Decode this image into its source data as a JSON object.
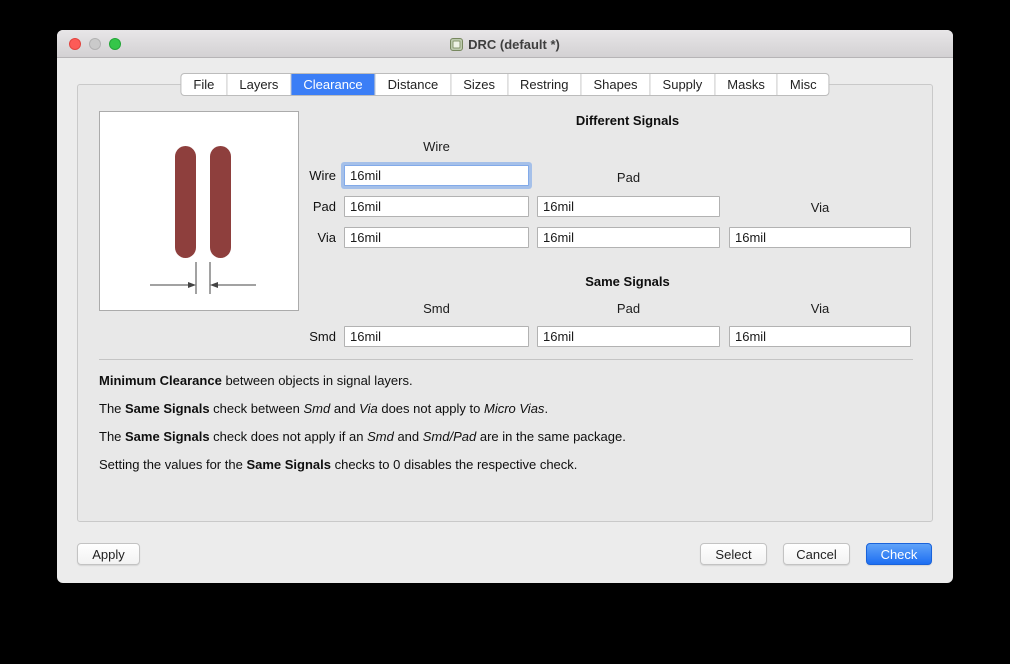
{
  "window": {
    "title": "DRC (default *)"
  },
  "tabs": {
    "items": [
      {
        "label": "File",
        "selected": false
      },
      {
        "label": "Layers",
        "selected": false
      },
      {
        "label": "Clearance",
        "selected": true
      },
      {
        "label": "Distance",
        "selected": false
      },
      {
        "label": "Sizes",
        "selected": false
      },
      {
        "label": "Restring",
        "selected": false
      },
      {
        "label": "Shapes",
        "selected": false
      },
      {
        "label": "Supply",
        "selected": false
      },
      {
        "label": "Masks",
        "selected": false
      },
      {
        "label": "Misc",
        "selected": false
      }
    ]
  },
  "clearance_tab": {
    "different_signals": {
      "heading": "Different Signals",
      "columns": {
        "wire": "Wire",
        "pad": "Pad",
        "via": "Via"
      },
      "rows": {
        "wire": {
          "label": "Wire",
          "wire": "16mil"
        },
        "pad": {
          "label": "Pad",
          "wire": "16mil",
          "pad": "16mil"
        },
        "via": {
          "label": "Via",
          "wire": "16mil",
          "pad": "16mil",
          "via": "16mil"
        }
      }
    },
    "same_signals": {
      "heading": "Same Signals",
      "columns": {
        "smd": "Smd",
        "pad": "Pad",
        "via": "Via"
      },
      "rows": {
        "smd": {
          "label": "Smd",
          "smd": "16mil",
          "pad": "16mil",
          "via": "16mil"
        }
      }
    },
    "notes": [
      [
        {
          "text": "Minimum Clearance",
          "style": "b"
        },
        {
          "text": " between objects in signal layers.",
          "style": ""
        }
      ],
      [
        {
          "text": "The ",
          "style": ""
        },
        {
          "text": "Same Signals",
          "style": "b"
        },
        {
          "text": " check between ",
          "style": ""
        },
        {
          "text": "Smd",
          "style": "i"
        },
        {
          "text": " and ",
          "style": ""
        },
        {
          "text": "Via",
          "style": "i"
        },
        {
          "text": " does not apply to ",
          "style": ""
        },
        {
          "text": "Micro Vias",
          "style": "i"
        },
        {
          "text": ".",
          "style": ""
        }
      ],
      [
        {
          "text": "The ",
          "style": ""
        },
        {
          "text": "Same Signals",
          "style": "b"
        },
        {
          "text": " check does not apply if an ",
          "style": ""
        },
        {
          "text": "Smd",
          "style": "i"
        },
        {
          "text": " and ",
          "style": ""
        },
        {
          "text": "Smd/Pad",
          "style": "i"
        },
        {
          "text": " are in the same package.",
          "style": ""
        }
      ],
      [
        {
          "text": "Setting the values for the ",
          "style": ""
        },
        {
          "text": "Same Signals",
          "style": "b"
        },
        {
          "text": " checks to 0 disables the respective check.",
          "style": ""
        }
      ]
    ]
  },
  "buttons": {
    "apply": "Apply",
    "select": "Select",
    "cancel": "Cancel",
    "check": "Check"
  },
  "colors": {
    "accent": "#3b7ef6",
    "wire_preview": "#8e3f3d"
  }
}
